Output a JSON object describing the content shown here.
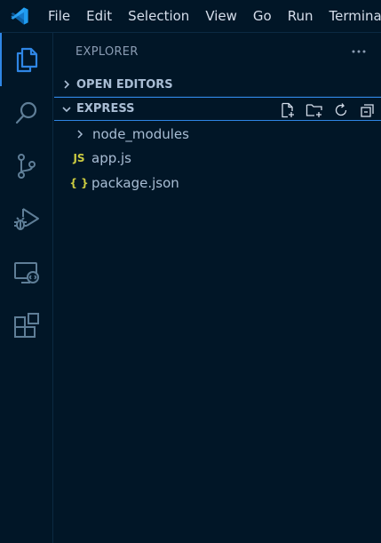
{
  "menubar": {
    "logo": "vscode-logo-icon",
    "items": [
      "File",
      "Edit",
      "Selection",
      "View",
      "Go",
      "Run",
      "Termina"
    ]
  },
  "activity_bar": {
    "items": [
      {
        "name": "explorer",
        "icon": "files-icon",
        "active": true
      },
      {
        "name": "search",
        "icon": "search-icon",
        "active": false
      },
      {
        "name": "source-control",
        "icon": "source-control-icon",
        "active": false
      },
      {
        "name": "run-debug",
        "icon": "run-debug-icon",
        "active": false
      },
      {
        "name": "remote-explorer",
        "icon": "remote-explorer-icon",
        "active": false
      },
      {
        "name": "extensions",
        "icon": "extensions-icon",
        "active": false
      }
    ]
  },
  "sidebar": {
    "title": "EXPLORER",
    "more_icon": "ellipsis-icon",
    "sections": {
      "open_editors": {
        "label": "OPEN EDITORS",
        "expanded": false
      },
      "workspace": {
        "label": "EXPRESS",
        "expanded": true,
        "actions": [
          "new-file-icon",
          "new-folder-icon",
          "refresh-icon",
          "collapse-all-icon"
        ]
      }
    },
    "tree": [
      {
        "name": "node_modules",
        "type": "folder",
        "expanded": false
      },
      {
        "name": "app.js",
        "type": "file",
        "icon_text": "JS",
        "icon_color": "#cbcb41"
      },
      {
        "name": "package.json",
        "type": "file",
        "icon_text": "{ }",
        "icon_color": "#cbcb41"
      }
    ]
  },
  "colors": {
    "background": "#011627",
    "accent": "#2f86e5",
    "icon": "#5f7e97",
    "text": "#a9bdd4"
  }
}
